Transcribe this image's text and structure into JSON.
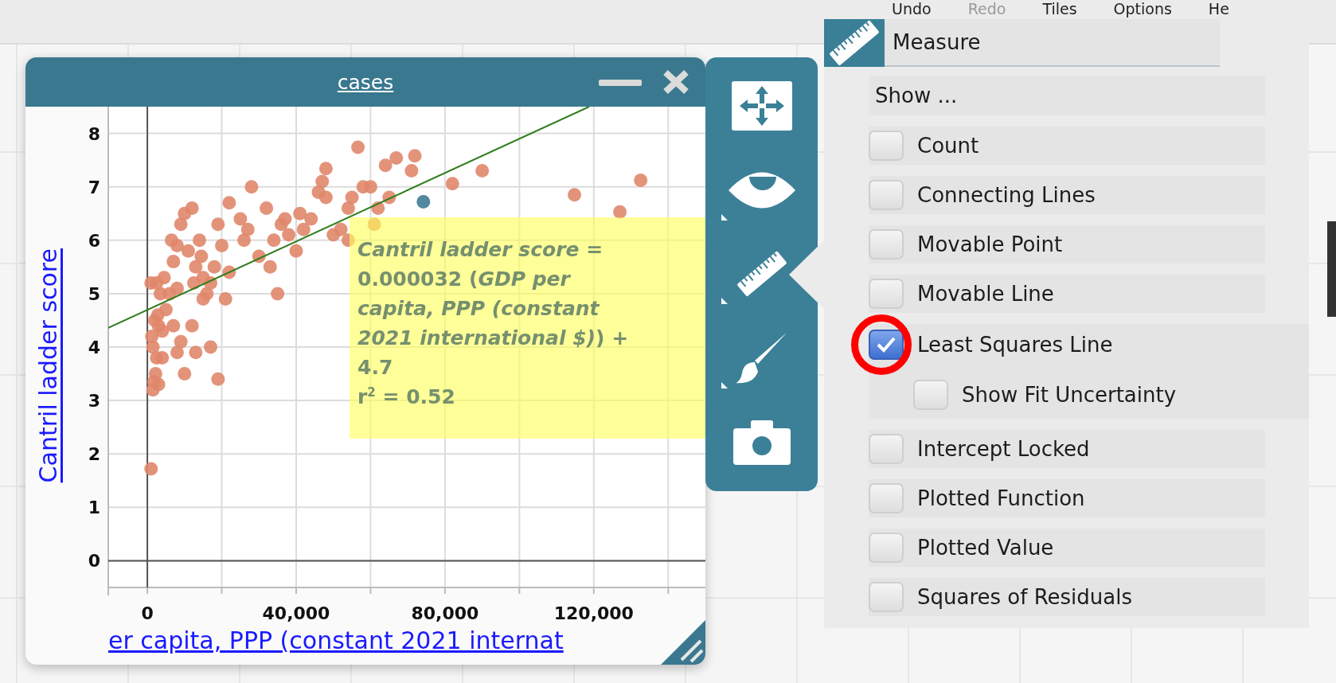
{
  "menu": [
    {
      "label": "Undo",
      "disabled": false
    },
    {
      "label": "Redo",
      "disabled": true
    },
    {
      "label": "Tiles",
      "disabled": false
    },
    {
      "label": "Options",
      "disabled": false
    },
    {
      "label": "He",
      "disabled": false
    }
  ],
  "graph": {
    "title": "cases",
    "chart_data": {
      "type": "scatter",
      "xlabel": "er capita, PPP (constant 2021 internat",
      "ylabel": "Cantril ladder score",
      "xlim": [
        -10500,
        150000
      ],
      "ylim": [
        -0.5,
        8.5
      ],
      "xticks": [
        {
          "value": 0,
          "label": "0"
        },
        {
          "value": 40000,
          "label": "40,000"
        },
        {
          "value": 80000,
          "label": "80,000"
        },
        {
          "value": 120000,
          "label": "120,000"
        }
      ],
      "yticks": [
        0,
        1,
        2,
        3,
        4,
        5,
        6,
        7,
        8
      ],
      "grid": true,
      "x": [
        1000,
        1500,
        1800,
        2200,
        2500,
        3000,
        1200,
        2000,
        3000,
        4000,
        1500,
        2800,
        1000,
        3500,
        4500,
        2500,
        5000,
        4000,
        7000,
        8000,
        9000,
        10000,
        12000,
        13000,
        17000,
        19000,
        6000,
        7000,
        8000,
        9000,
        10000,
        12000,
        11000,
        13000,
        14000,
        15000,
        16000,
        17000,
        8000,
        6500,
        12500,
        14500,
        18000,
        19000,
        20000,
        21000,
        22000,
        15000,
        22000,
        25000,
        26000,
        27000,
        28000,
        30000,
        32000,
        33000,
        34000,
        35000,
        36000,
        37000,
        38000,
        40000,
        41000,
        42000,
        44000,
        46000,
        47000,
        48000,
        48000,
        50000,
        52000,
        54000,
        55000,
        56600,
        58000,
        60000,
        62000,
        64000,
        65000,
        66900,
        71000,
        71900,
        54000,
        61000,
        82000,
        90000,
        114800,
        127000,
        132600,
        74200,
        -10500,
        118750
      ],
      "series": [
        {
          "color": "#e0876a",
          "values": [
            1.72,
            3.2,
            3.35,
            3.5,
            3.8,
            3.3,
            4.2,
            4.5,
            4.4,
            4.3,
            4.0,
            4.6,
            5.2,
            5.0,
            5.3,
            5.2,
            4.7,
            3.8,
            4.4,
            3.9,
            4.1,
            3.5,
            4.4,
            3.9,
            4.0,
            3.4,
            5.0,
            5.6,
            5.9,
            6.3,
            6.5,
            6.6,
            5.8,
            5.5,
            6.0,
            5.3,
            5.0,
            5.2,
            5.1,
            6.0,
            5.2,
            5.7,
            5.5,
            6.3,
            5.9,
            4.9,
            5.4,
            4.9,
            6.7,
            6.4,
            6.0,
            6.2,
            7.0,
            5.7,
            6.6,
            5.5,
            6.0,
            5.0,
            6.3,
            6.4,
            6.1,
            5.8,
            6.5,
            6.2,
            6.4,
            6.9,
            7.1,
            6.8,
            7.34,
            6.1,
            6.2,
            6.6,
            6.8,
            7.74,
            7.0,
            7.0,
            6.6,
            7.4,
            6.8,
            7.54,
            7.3,
            7.58,
            6.0,
            6.3,
            7.06,
            7.3,
            6.85,
            6.53,
            7.12,
            null,
            null,
            null
          ]
        },
        {
          "color": "#3f7b96",
          "values": [
            null,
            null,
            null,
            null,
            null,
            null,
            null,
            null,
            null,
            null,
            null,
            null,
            null,
            null,
            null,
            null,
            null,
            null,
            null,
            null,
            null,
            null,
            null,
            null,
            null,
            null,
            null,
            null,
            null,
            null,
            null,
            null,
            null,
            null,
            null,
            null,
            null,
            null,
            null,
            null,
            null,
            null,
            null,
            null,
            null,
            null,
            null,
            null,
            null,
            null,
            null,
            null,
            null,
            null,
            null,
            null,
            null,
            null,
            null,
            null,
            null,
            null,
            null,
            null,
            null,
            null,
            null,
            null,
            null,
            null,
            null,
            null,
            null,
            null,
            null,
            null,
            null,
            null,
            null,
            null,
            null,
            null,
            null,
            null,
            null,
            null,
            null,
            null,
            null,
            6.72,
            null,
            null
          ]
        },
        {
          "type": "line",
          "color": "#2f7d1c",
          "values": [
            null,
            null,
            null,
            null,
            null,
            null,
            null,
            null,
            null,
            null,
            null,
            null,
            null,
            null,
            null,
            null,
            null,
            null,
            null,
            null,
            null,
            null,
            null,
            null,
            null,
            null,
            null,
            null,
            null,
            null,
            null,
            null,
            null,
            null,
            null,
            null,
            null,
            null,
            null,
            null,
            null,
            null,
            null,
            null,
            null,
            null,
            null,
            null,
            null,
            null,
            null,
            null,
            null,
            null,
            null,
            null,
            null,
            null,
            null,
            null,
            null,
            null,
            null,
            null,
            null,
            null,
            null,
            null,
            null,
            null,
            null,
            null,
            null,
            null,
            null,
            null,
            null,
            null,
            null,
            null,
            null,
            null,
            null,
            null,
            null,
            null,
            null,
            null,
            null,
            null,
            4.36,
            8.5
          ]
        }
      ]
    },
    "equation": [
      "*Cantril ladder score* = 0.000032 (*GDP per capita, PPP (constant 2021 international $)*) + 4.7",
      "r$^{2}$ = 0.52"
    ]
  },
  "tools": [
    {
      "kind": "move",
      "selected": false,
      "submenu": false
    },
    {
      "kind": "eye",
      "selected": false,
      "submenu": true
    },
    {
      "kind": "ruler",
      "selected": true,
      "submenu": true
    },
    {
      "kind": "brush",
      "selected": false,
      "submenu": true
    },
    {
      "kind": "camera",
      "selected": false,
      "submenu": false
    }
  ],
  "measure": {
    "title": "Measure",
    "options": [
      {
        "kind": "heading",
        "label": "Show ..."
      },
      {
        "kind": "checkbox",
        "label": "Count",
        "checked": false,
        "circled": false
      },
      {
        "kind": "checkbox",
        "label": "Connecting Lines",
        "checked": false,
        "circled": false
      },
      {
        "kind": "checkbox",
        "label": "Movable Point",
        "checked": false,
        "circled": false
      },
      {
        "kind": "checkbox",
        "label": "Movable Line",
        "checked": false,
        "circled": false
      },
      {
        "kind": "checkbox",
        "label": "Least Squares Line",
        "checked": true,
        "circled": true,
        "children": [
          {
            "kind": "checkbox",
            "label": "Show Fit Uncertainty",
            "checked": false,
            "circled": false
          }
        ]
      },
      {
        "kind": "checkbox",
        "label": "Intercept Locked",
        "checked": false,
        "circled": false
      },
      {
        "kind": "checkbox",
        "label": "Plotted Function",
        "checked": false,
        "circled": false
      },
      {
        "kind": "checkbox",
        "label": "Plotted Value",
        "checked": false,
        "circled": false
      },
      {
        "kind": "checkbox",
        "label": "Squares of Residuals",
        "checked": false,
        "circled": false
      }
    ]
  }
}
